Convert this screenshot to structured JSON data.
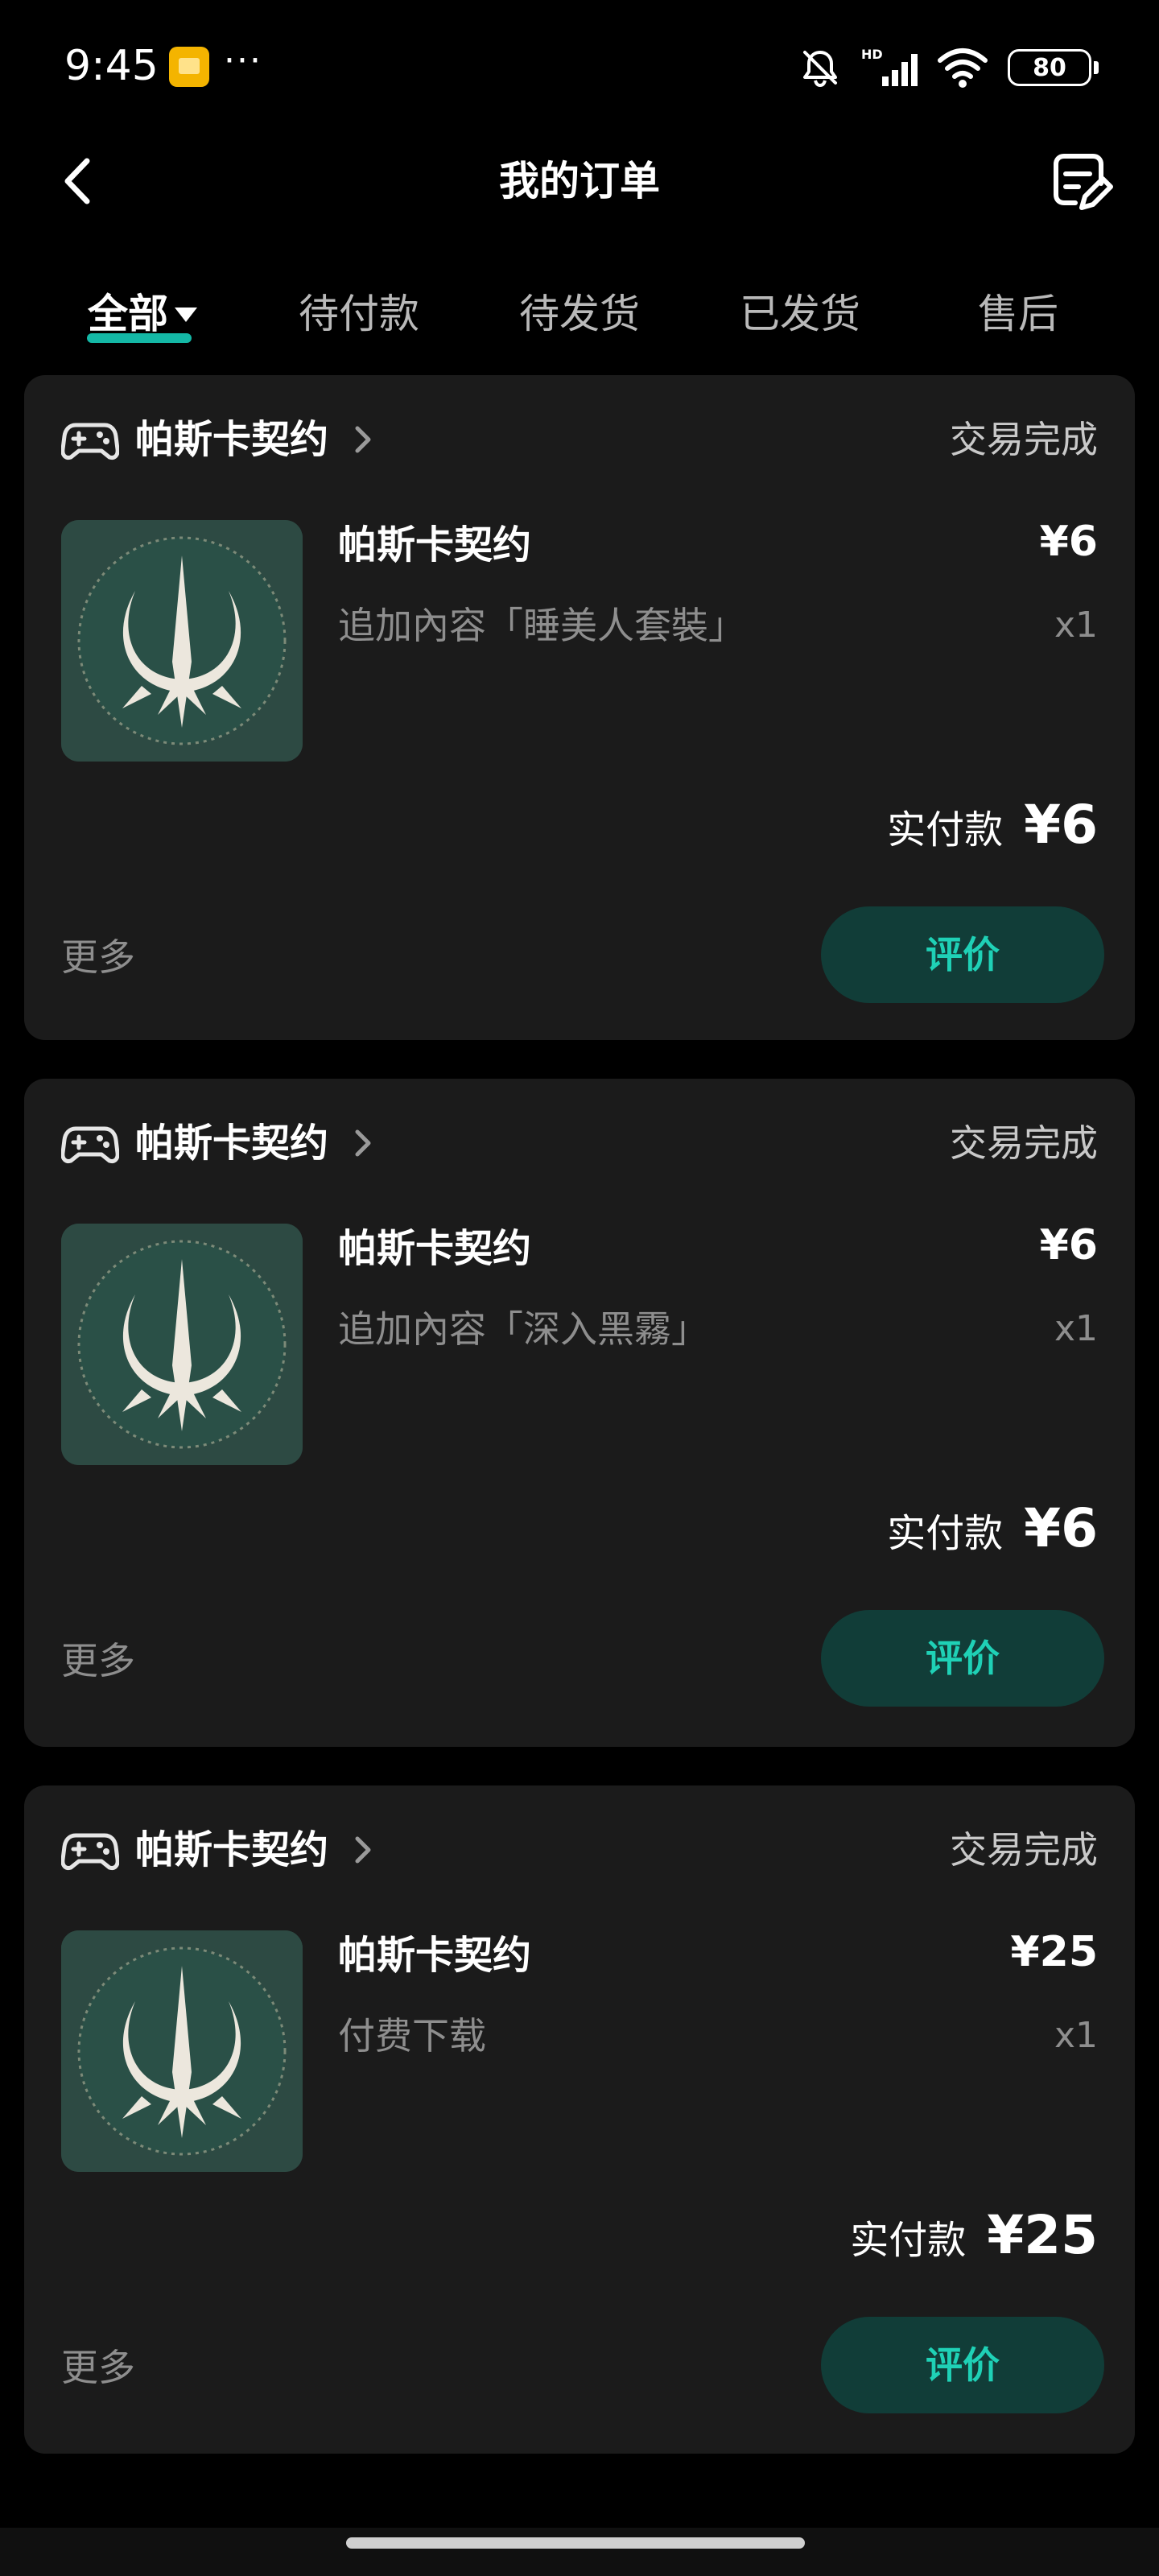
{
  "status_bar": {
    "time": "9:45",
    "more_dots": "···",
    "battery_level": "80",
    "icons": [
      "app-notification-icon",
      "mute-bell-icon",
      "hd-signal-icon",
      "wifi-icon",
      "battery-icon"
    ]
  },
  "header": {
    "title": "我的订单",
    "back_icon": "chevron-left-icon",
    "action_icon": "feedback-edit-icon"
  },
  "tabs": [
    {
      "label": "全部",
      "active": true
    },
    {
      "label": "待付款",
      "active": false
    },
    {
      "label": "待发货",
      "active": false
    },
    {
      "label": "已发货",
      "active": false
    },
    {
      "label": "售后",
      "active": false
    }
  ],
  "colors": {
    "background": "#000000",
    "card": "#1b1b1b",
    "accent": "#1fd1b6",
    "review_button_bg": "#113d38",
    "tab_underline": "#14b8a6"
  },
  "orders": [
    {
      "store_name": "帕斯卡契约",
      "status": "交易完成",
      "product_name": "帕斯卡契约",
      "product_desc": "追加內容「睡美人套裝」",
      "price": "¥6",
      "qty": "x1",
      "paid_label": "实付款",
      "paid_amount": "¥6",
      "more": "更多",
      "review_label": "评价"
    },
    {
      "store_name": "帕斯卡契约",
      "status": "交易完成",
      "product_name": "帕斯卡契约",
      "product_desc": "追加內容「深入黑霧」",
      "price": "¥6",
      "qty": "x1",
      "paid_label": "实付款",
      "paid_amount": "¥6",
      "more": "更多",
      "review_label": "评价"
    },
    {
      "store_name": "帕斯卡契约",
      "status": "交易完成",
      "product_name": "帕斯卡契约",
      "product_desc": "付费下载",
      "price": "¥25",
      "qty": "x1",
      "paid_label": "实付款",
      "paid_amount": "¥25",
      "more": "更多",
      "review_label": "评价"
    }
  ]
}
